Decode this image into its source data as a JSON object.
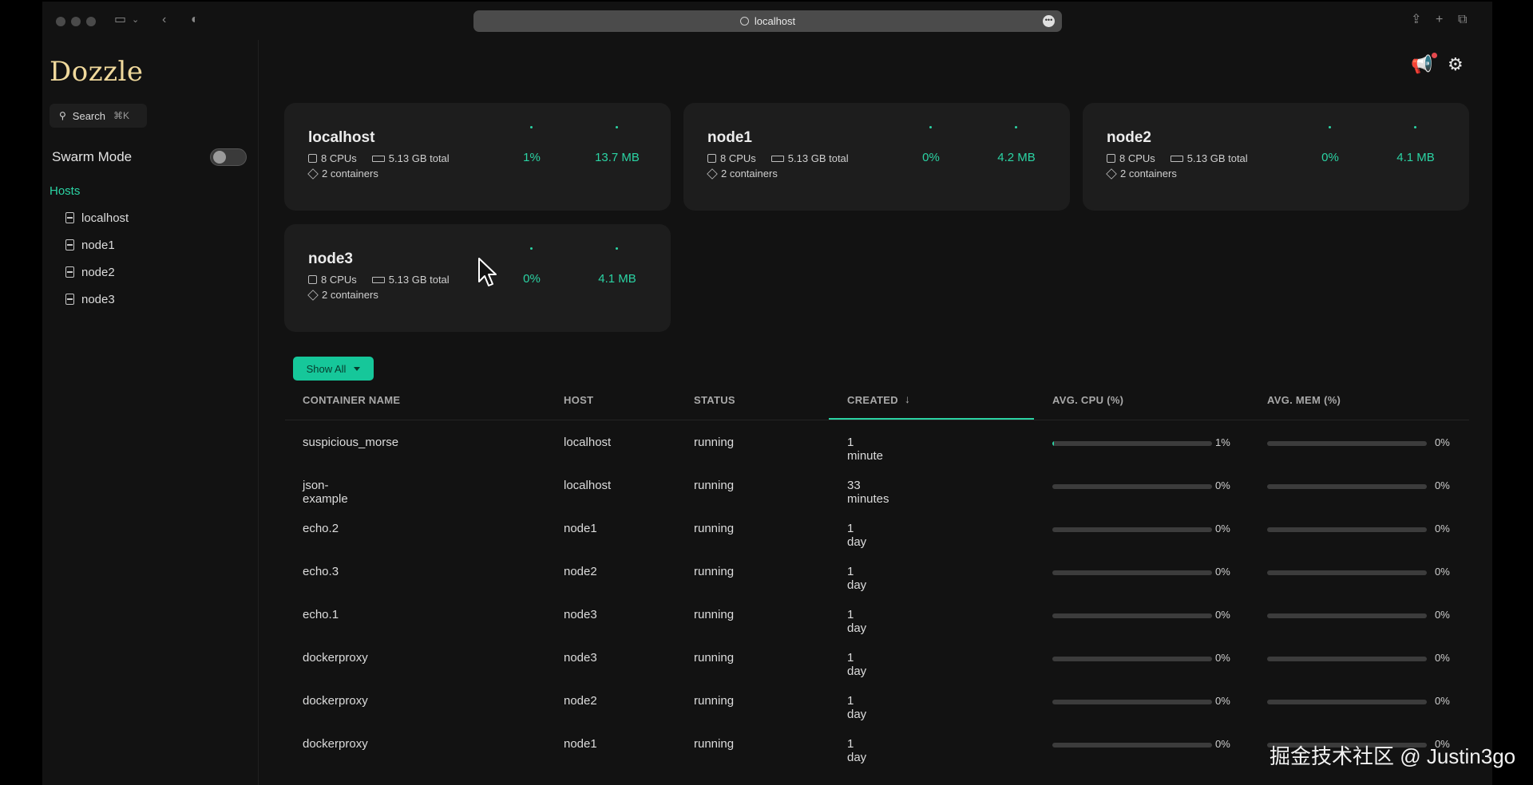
{
  "browser": {
    "url": "localhost"
  },
  "sidebar": {
    "logo": "Dozzle",
    "search_label": "Search",
    "search_shortcut": "⌘K",
    "swarm_label": "Swarm Mode",
    "swarm_enabled": false,
    "hosts_heading": "Hosts",
    "hosts": [
      "localhost",
      "node1",
      "node2",
      "node3"
    ]
  },
  "cards": [
    {
      "name": "localhost",
      "cpus": "8 CPUs",
      "memory": "5.13 GB total",
      "containers": "2 containers",
      "cpu": "1%",
      "mem": "13.7 MB"
    },
    {
      "name": "node1",
      "cpus": "8 CPUs",
      "memory": "5.13 GB total",
      "containers": "2 containers",
      "cpu": "0%",
      "mem": "4.2 MB"
    },
    {
      "name": "node2",
      "cpus": "8 CPUs",
      "memory": "5.13 GB total",
      "containers": "2 containers",
      "cpu": "0%",
      "mem": "4.1 MB"
    },
    {
      "name": "node3",
      "cpus": "8 CPUs",
      "memory": "5.13 GB total",
      "containers": "2 containers",
      "cpu": "0%",
      "mem": "4.1 MB"
    }
  ],
  "filter": {
    "label": "Show All"
  },
  "table": {
    "columns": [
      "CONTAINER NAME",
      "HOST",
      "STATUS",
      "CREATED",
      "AVG. CPU (%)",
      "AVG. MEM (%)"
    ],
    "sort_column": "CREATED",
    "rows": [
      {
        "name": "suspicious_morse",
        "host": "localhost",
        "status": "running",
        "created": "1 minute",
        "cpu": "1%",
        "mem": "0%",
        "cpu_fraction": 0.01,
        "mem_fraction": 0
      },
      {
        "name": "json-example",
        "host": "localhost",
        "status": "running",
        "created": "33 minutes",
        "cpu": "0%",
        "mem": "0%",
        "cpu_fraction": 0,
        "mem_fraction": 0
      },
      {
        "name": "echo.2",
        "host": "node1",
        "status": "running",
        "created": "1 day",
        "cpu": "0%",
        "mem": "0%",
        "cpu_fraction": 0,
        "mem_fraction": 0
      },
      {
        "name": "echo.3",
        "host": "node2",
        "status": "running",
        "created": "1 day",
        "cpu": "0%",
        "mem": "0%",
        "cpu_fraction": 0,
        "mem_fraction": 0
      },
      {
        "name": "echo.1",
        "host": "node3",
        "status": "running",
        "created": "1 day",
        "cpu": "0%",
        "mem": "0%",
        "cpu_fraction": 0,
        "mem_fraction": 0
      },
      {
        "name": "dockerproxy",
        "host": "node3",
        "status": "running",
        "created": "1 day",
        "cpu": "0%",
        "mem": "0%",
        "cpu_fraction": 0,
        "mem_fraction": 0
      },
      {
        "name": "dockerproxy",
        "host": "node2",
        "status": "running",
        "created": "1 day",
        "cpu": "0%",
        "mem": "0%",
        "cpu_fraction": 0,
        "mem_fraction": 0
      },
      {
        "name": "dockerproxy",
        "host": "node1",
        "status": "running",
        "created": "1 day",
        "cpu": "0%",
        "mem": "0%",
        "cpu_fraction": 0,
        "mem_fraction": 0
      }
    ]
  },
  "watermark": "掘金技术社区 @ Justin3go",
  "colors": {
    "accent": "#2bd4a4",
    "logo": "#f0d99c",
    "background": "#121212",
    "card": "#1d1d1d"
  }
}
